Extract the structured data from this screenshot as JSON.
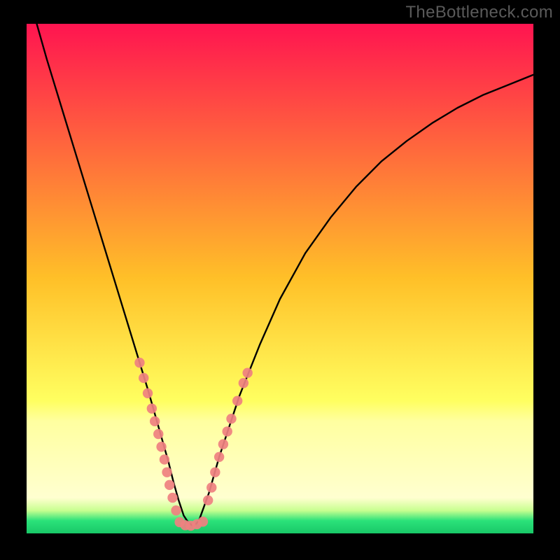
{
  "watermark": "TheBottleneck.com",
  "chart_data": {
    "type": "line",
    "title": "",
    "xlabel": "",
    "ylabel": "",
    "xlim": [
      0,
      100
    ],
    "ylim": [
      0,
      100
    ],
    "grid": false,
    "legend": "none",
    "background_gradient": {
      "stops": [
        {
          "offset": 0.0,
          "color": "#ff1450"
        },
        {
          "offset": 0.5,
          "color": "#ffc028"
        },
        {
          "offset": 0.74,
          "color": "#ffff60"
        },
        {
          "offset": 0.78,
          "color": "#ffffa0"
        },
        {
          "offset": 0.93,
          "color": "#ffffd0"
        },
        {
          "offset": 0.955,
          "color": "#c8ff90"
        },
        {
          "offset": 0.975,
          "color": "#2be27a"
        },
        {
          "offset": 1.0,
          "color": "#18c867"
        }
      ]
    },
    "series": [
      {
        "name": "bottleneck-curve",
        "type": "line",
        "stroke": "#000000",
        "x": [
          2,
          4,
          6,
          8,
          10,
          12,
          14,
          16,
          18,
          20,
          22,
          24,
          26,
          27,
          28,
          29,
          30,
          31,
          32,
          33,
          34,
          36,
          38,
          42,
          46,
          50,
          55,
          60,
          65,
          70,
          75,
          80,
          85,
          90,
          95,
          100
        ],
        "y": [
          100,
          93,
          86.5,
          80,
          73.5,
          67,
          60.5,
          54,
          47.5,
          41,
          34.5,
          28,
          21,
          17.5,
          14,
          10,
          6.5,
          3.5,
          2,
          1.4,
          2.5,
          8,
          15,
          27,
          37,
          46,
          55,
          62,
          68,
          73,
          77,
          80.5,
          83.5,
          86,
          88,
          90
        ]
      },
      {
        "name": "marker-dots-left",
        "type": "scatter",
        "color": "#ef8080",
        "x": [
          22.3,
          23.1,
          23.9,
          24.7,
          25.3,
          26.0,
          26.6,
          27.2,
          27.7,
          28.2,
          28.8,
          29.5
        ],
        "y": [
          33.5,
          30.5,
          27.5,
          24.5,
          22.0,
          19.5,
          17.0,
          14.5,
          12.0,
          9.5,
          7.0,
          4.5
        ]
      },
      {
        "name": "marker-dots-bottom",
        "type": "scatter",
        "color": "#ef8080",
        "x": [
          30.2,
          31.3,
          32.4,
          33.6,
          34.8
        ],
        "y": [
          2.2,
          1.6,
          1.5,
          1.8,
          2.3
        ]
      },
      {
        "name": "marker-dots-right",
        "type": "scatter",
        "color": "#ef8080",
        "x": [
          35.8,
          36.5,
          37.2,
          38.0,
          38.8,
          39.6,
          40.4,
          41.6,
          42.8,
          43.6
        ],
        "y": [
          6.5,
          9.0,
          12.0,
          15.0,
          17.5,
          20.0,
          22.5,
          26.0,
          29.5,
          31.5
        ]
      }
    ]
  }
}
